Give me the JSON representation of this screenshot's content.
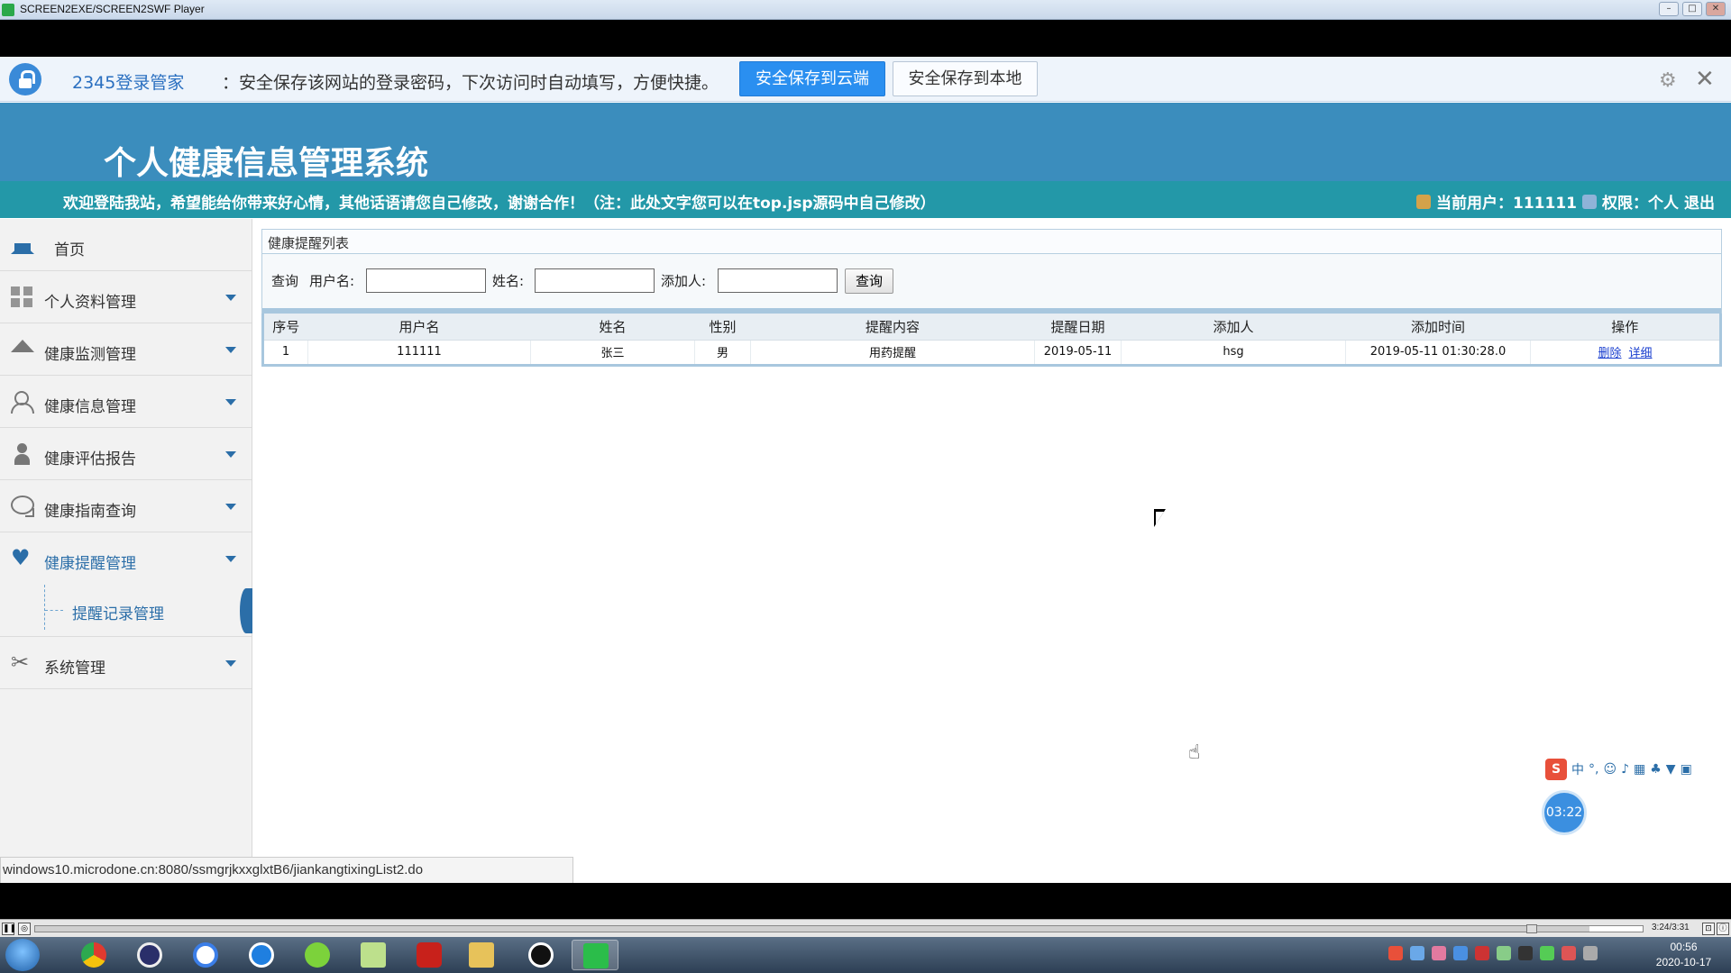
{
  "player": {
    "title": "SCREEN2EXE/SCREEN2SWF Player",
    "time": "3:24/3:31",
    "progress": 0.967
  },
  "password_bar": {
    "brand": "2345登录管家",
    "message": "：安全保存该网站的登录密码，下次访问时自动填写，方便快捷。",
    "cloud_button": "安全保存到云端",
    "local_button": "安全保存到本地"
  },
  "site": {
    "title": "个人健康信息管理系统",
    "welcome": "欢迎登陆我站，希望能给你带来好心情，其他话语请您自己修改，谢谢合作！（注：此处文字您可以在top.jsp源码中自己修改）",
    "current_user_label": "当前用户：111111",
    "role_label": "权限：个人",
    "logout": "退出"
  },
  "sidebar": {
    "items": [
      {
        "label": "首页",
        "icon": "home-icon"
      },
      {
        "label": "个人资料管理",
        "icon": "grid-icon"
      },
      {
        "label": "健康监测管理",
        "icon": "roof-icon"
      },
      {
        "label": "健康信息管理",
        "icon": "users-icon"
      },
      {
        "label": "健康评估报告",
        "icon": "person-icon"
      },
      {
        "label": "健康指南查询",
        "icon": "chat-icon"
      },
      {
        "label": "健康提醒管理",
        "icon": "heart-icon"
      },
      {
        "label": "系统管理",
        "icon": "tools-icon"
      }
    ],
    "sub_item": "提醒记录管理"
  },
  "panel": {
    "title": "健康提醒列表",
    "search": {
      "prefix": "查询",
      "username_label": "用户名:",
      "name_label": "姓名:",
      "adder_label": "添加人:",
      "button": "查询"
    },
    "table": {
      "headers": [
        "序号",
        "用户名",
        "姓名",
        "性别",
        "提醒内容",
        "提醒日期",
        "添加人",
        "添加时间",
        "操作"
      ],
      "rows": [
        {
          "index": "1",
          "username": "111111",
          "name": "张三",
          "gender": "男",
          "content": "用药提醒",
          "date": "2019-05-11",
          "adder": "hsg",
          "added_time": "2019-05-11 01:30:28.0",
          "delete": "删除",
          "detail": "详细"
        }
      ]
    }
  },
  "status_url": "windows10.microdone.cn:8080/ssmgrjkxxglxtB6/jiankangtixingList2.do",
  "ime": {
    "logo": "S",
    "mode": "中"
  },
  "timer": "03:22",
  "clock": {
    "time": "00:56",
    "date": "2020-10-17"
  }
}
